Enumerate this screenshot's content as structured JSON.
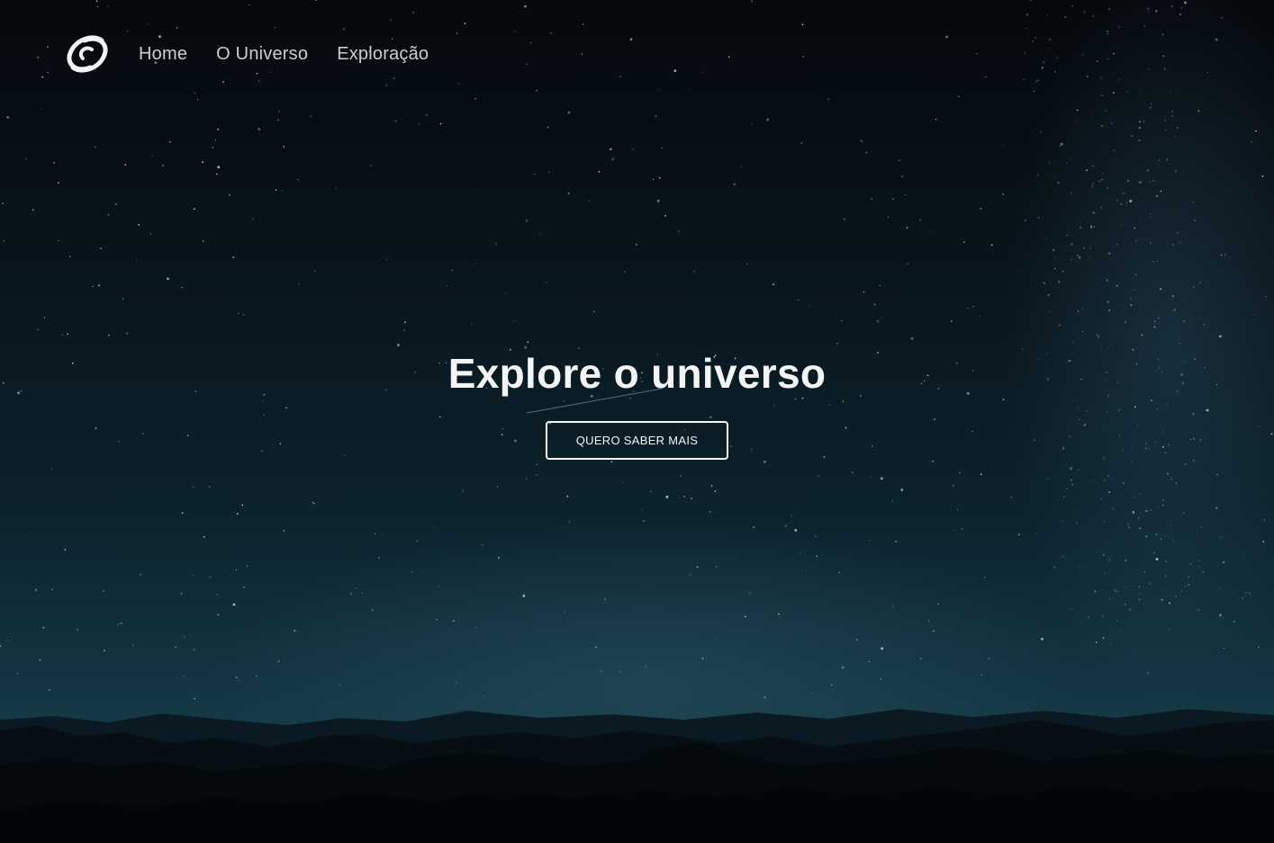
{
  "nav": {
    "logo_icon": "swirl-galaxy-logo-icon",
    "items": [
      {
        "label": "Home"
      },
      {
        "label": "O Universo"
      },
      {
        "label": "Exploração"
      }
    ]
  },
  "hero": {
    "title": "Explore o universo",
    "cta_label": "QUERO SABER MAIS"
  },
  "colors": {
    "text": "#f2f4f5",
    "nav_text": "#c9cfd3",
    "sky_top": "#05090d",
    "sky_horizon": "#143845",
    "mountains": "#05090c"
  }
}
